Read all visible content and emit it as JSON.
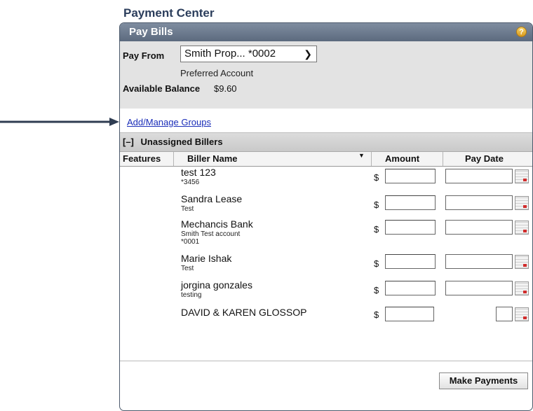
{
  "page_title": "Payment Center",
  "panel": {
    "title": "Pay Bills",
    "help_icon": "?"
  },
  "account": {
    "pay_from_label": "Pay From",
    "selected_account": "Smith Prop... *0002",
    "preferred_note": "Preferred Account",
    "available_balance_label": "Available Balance",
    "available_balance_value": "$9.60"
  },
  "groups_link": "Add/Manage Groups",
  "section": {
    "toggle": "[–]",
    "title": "Unassigned Billers"
  },
  "columns": {
    "features": "Features",
    "biller_name": "Biller Name",
    "amount": "Amount",
    "pay_date": "Pay Date"
  },
  "billers": [
    {
      "name": "test 123",
      "sub1": "*3456",
      "sub2": ""
    },
    {
      "name": "Sandra Lease",
      "sub1": "Test",
      "sub2": ""
    },
    {
      "name": "Mechancis Bank",
      "sub1": "Smith Test account",
      "sub2": "*0001"
    },
    {
      "name": "Marie Ishak",
      "sub1": "Test",
      "sub2": ""
    },
    {
      "name": "jorgina gonzales",
      "sub1": "testing",
      "sub2": ""
    },
    {
      "name": "DAVID & KAREN GLOSSOP",
      "sub1": "",
      "sub2": ""
    }
  ],
  "currency_symbol": "$",
  "make_payments_label": "Make Payments",
  "icons": {
    "arrow": "left-pointing annotation arrow",
    "calendar": "calendar-icon",
    "dropdown": "chevron-down-icon"
  }
}
